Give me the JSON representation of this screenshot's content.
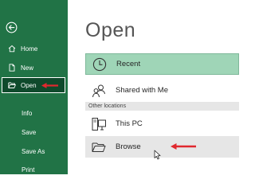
{
  "sidebar": {
    "background": "#217346",
    "back_icon": "circle-arrow-left-icon",
    "items": [
      {
        "label": "Home",
        "icon": "home-icon"
      },
      {
        "label": "New",
        "icon": "new-document-icon"
      },
      {
        "label": "Open",
        "icon": "open-folder-icon",
        "selected": true
      },
      {
        "label": "Info"
      },
      {
        "label": "Save"
      },
      {
        "label": "Save As"
      },
      {
        "label": "Print"
      }
    ]
  },
  "main": {
    "title": "Open",
    "locations": [
      {
        "label": "Recent",
        "icon": "clock-icon",
        "selected": true
      },
      {
        "label": "Shared with Me",
        "icon": "people-icon"
      }
    ],
    "other_locations_label": "Other locations",
    "other_locations": [
      {
        "label": "This PC",
        "icon": "computer-icon"
      },
      {
        "label": "Browse",
        "icon": "folder-icon",
        "hovered": true
      }
    ]
  },
  "colors": {
    "accent": "#217346",
    "selected": "#9fd5b7",
    "annotation": "#e0282e"
  }
}
